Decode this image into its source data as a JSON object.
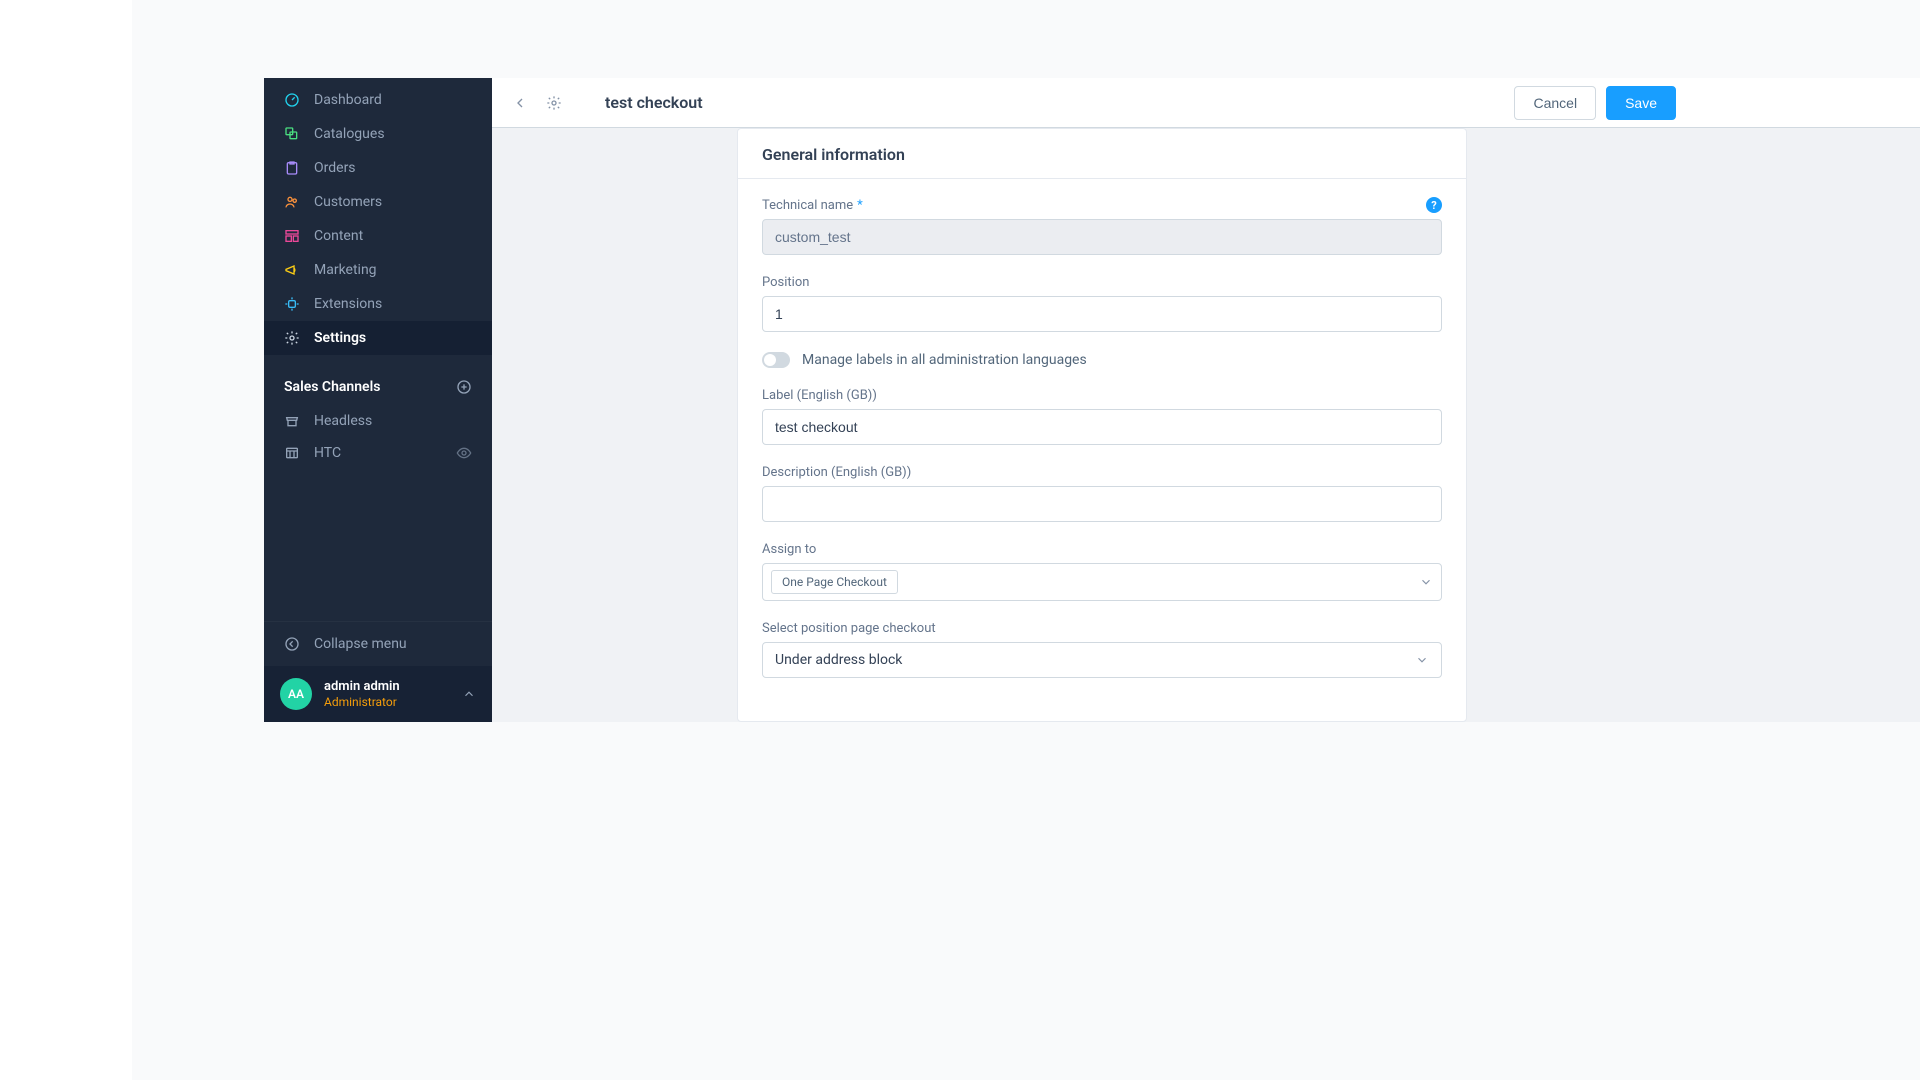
{
  "sidebar": {
    "nav": [
      {
        "label": "Dashboard",
        "icon": "gauge",
        "color": "#22d3ee"
      },
      {
        "label": "Catalogues",
        "icon": "layers",
        "color": "#4ade80"
      },
      {
        "label": "Orders",
        "icon": "clipboard",
        "color": "#a78bfa"
      },
      {
        "label": "Customers",
        "icon": "users",
        "color": "#fb923c"
      },
      {
        "label": "Content",
        "icon": "layout",
        "color": "#ec4899"
      },
      {
        "label": "Marketing",
        "icon": "megaphone",
        "color": "#facc15"
      },
      {
        "label": "Extensions",
        "icon": "plug",
        "color": "#38bdf8"
      },
      {
        "label": "Settings",
        "icon": "gear",
        "color": "#cbd5e1",
        "active": true
      }
    ],
    "channels_header": "Sales Channels",
    "channels": [
      {
        "label": "Headless",
        "icon": "storefront"
      },
      {
        "label": "HTC",
        "icon": "storefront-grid",
        "eye": true
      }
    ],
    "collapse_label": "Collapse menu",
    "user": {
      "initials": "AA",
      "name": "admin admin",
      "role": "Administrator"
    }
  },
  "topbar": {
    "title": "test checkout",
    "cancel_label": "Cancel",
    "save_label": "Save"
  },
  "form": {
    "section_title": "General information",
    "technical_name_label": "Technical name",
    "technical_name_value": "custom_test",
    "position_label": "Position",
    "position_value": "1",
    "manage_labels_label": "Manage labels in all administration languages",
    "label_label": "Label (English (GB))",
    "label_value": "test checkout",
    "description_label": "Description (English (GB))",
    "description_value": "",
    "assign_to_label": "Assign to",
    "assign_to_chip": "One Page Checkout",
    "position_page_label": "Select position page checkout",
    "position_page_value": "Under address block"
  }
}
